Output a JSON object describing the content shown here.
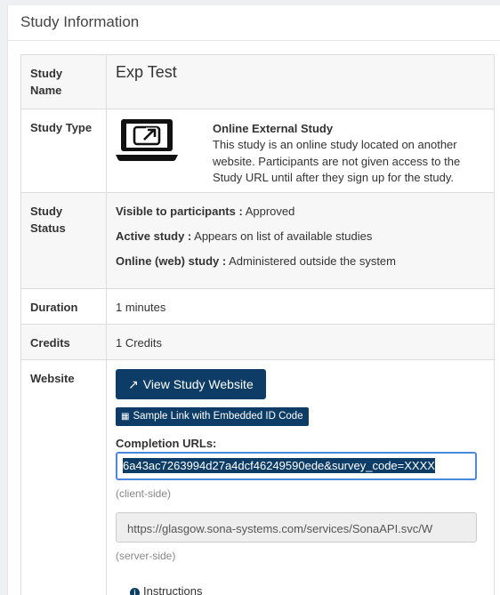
{
  "panel": {
    "title": "Study Information"
  },
  "rows": {
    "name": {
      "label": "Study Name",
      "value": "Exp Test"
    },
    "type": {
      "label": "Study Type",
      "icon": "laptop-external-link-icon",
      "title": "Online External Study",
      "description": "This study is an online study located on another website. Participants are not given access to the Study URL until after they sign up for the study."
    },
    "status": {
      "label": "Study Status",
      "lines": [
        {
          "key": "Visible to participants :",
          "value": " Approved"
        },
        {
          "key": "Active study :",
          "value": " Appears on list of available studies"
        },
        {
          "key": "Online (web) study :",
          "value": " Administered outside the system"
        }
      ]
    },
    "duration": {
      "label": "Duration",
      "value": "1 minutes"
    },
    "credits": {
      "label": "Credits",
      "value": "1 Credits"
    },
    "website": {
      "label": "Website",
      "view_button": "View Study Website",
      "sample_button": "Sample Link with Embedded ID Code",
      "completion_label": "Completion URLs:",
      "client_url": "6a43ac7263994d27a4dcf46249590ede&survey_code=XXXX",
      "client_note": "(client-side)",
      "server_url": "https://glasgow.sona-systems.com/services/SonaAPI.svc/W",
      "server_note": "(server-side)",
      "instructions": "Instructions"
    }
  }
}
